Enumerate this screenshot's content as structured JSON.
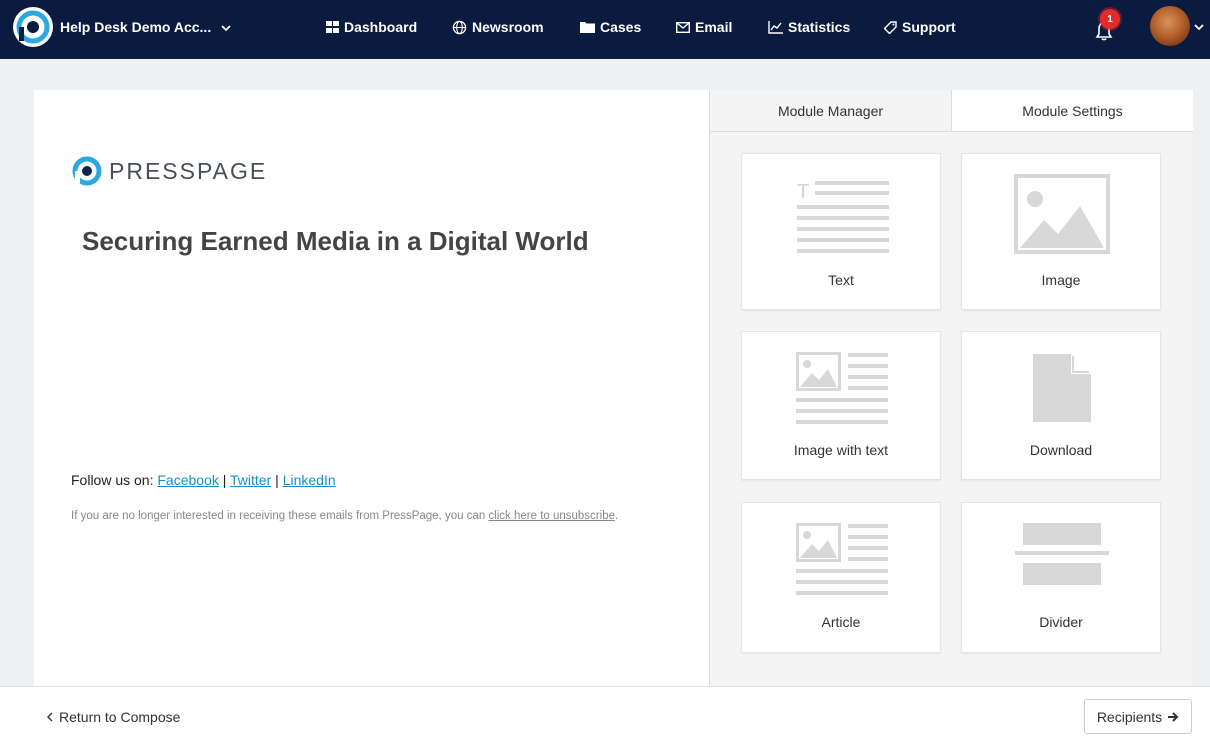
{
  "header": {
    "account_name": "Help Desk Demo Acc...",
    "nav": [
      {
        "label": "Dashboard",
        "icon": "grid-icon"
      },
      {
        "label": "Newsroom",
        "icon": "globe-icon"
      },
      {
        "label": "Cases",
        "icon": "folder-icon"
      },
      {
        "label": "Email",
        "icon": "envelope-icon"
      },
      {
        "label": "Statistics",
        "icon": "line-chart-icon"
      },
      {
        "label": "Support",
        "icon": "tag-icon"
      }
    ],
    "notification_count": "1"
  },
  "preview": {
    "logo_text": "PRESSPAGE",
    "headline": "Securing Earned Media in a Digital World",
    "follow_prefix": "Follow us on: ",
    "social_links": [
      "Facebook",
      "Twitter",
      "LinkedIn"
    ],
    "separator": " | ",
    "unsubscribe_text": "If you are no longer interested in receiving these emails from PressPage, you can ",
    "unsubscribe_link": "click here to unsubscribe",
    "unsubscribe_end": "."
  },
  "panel": {
    "tabs": [
      "Module Manager",
      "Module Settings"
    ],
    "modules": [
      {
        "label": "Text",
        "icon": "text-module-icon"
      },
      {
        "label": "Image",
        "icon": "image-module-icon"
      },
      {
        "label": "Image with text",
        "icon": "image-with-text-module-icon"
      },
      {
        "label": "Download",
        "icon": "download-module-icon"
      },
      {
        "label": "Article",
        "icon": "article-module-icon"
      },
      {
        "label": "Divider",
        "icon": "divider-module-icon"
      }
    ]
  },
  "footer": {
    "back_label": "Return to Compose",
    "next_label": "Recipients"
  },
  "colors": {
    "topbar": "#0b1b3f",
    "link": "#1a8ec4",
    "logo_accent": "#29a9e0",
    "badge": "#e32b2b",
    "module_icon": "#d8d8d8"
  }
}
